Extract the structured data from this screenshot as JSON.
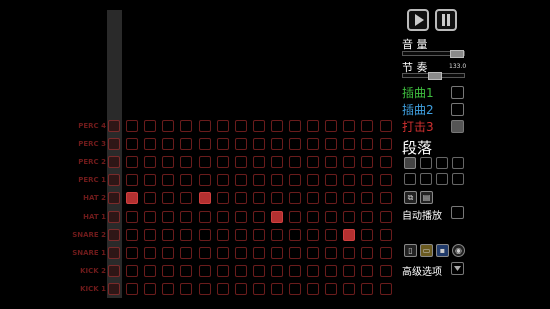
{
  "transport": {
    "play_icon": "play-icon",
    "pause_icon": "pause-icon"
  },
  "volume": {
    "label": "音 量",
    "level": 0.95
  },
  "tempo": {
    "label": "节 奏",
    "value": "133.0",
    "level": 0.5
  },
  "tracks": [
    {
      "label": "插曲1",
      "color": "#3fbf3f",
      "checked": false
    },
    {
      "label": "插曲2",
      "color": "#3f9fdf",
      "checked": false
    },
    {
      "label": "打击3",
      "color": "#d03030",
      "checked": true
    }
  ],
  "section": {
    "label": "段落"
  },
  "autoplay": {
    "label": "自动播放"
  },
  "advanced": {
    "label": "高级选项"
  },
  "grid": {
    "rows": [
      "PERC 4",
      "PERC 3",
      "PERC 2",
      "PERC 1",
      "HAT 2",
      "HAT 1",
      "SNARE 2",
      "SNARE 1",
      "KICK 2",
      "KICK 1"
    ],
    "steps": 16,
    "active": [
      [
        4,
        1
      ],
      [
        4,
        5
      ],
      [
        5,
        9
      ],
      [
        6,
        13
      ]
    ]
  },
  "colors": {
    "grid_border": "#6a1c1c",
    "active_cell": "#b33030"
  }
}
